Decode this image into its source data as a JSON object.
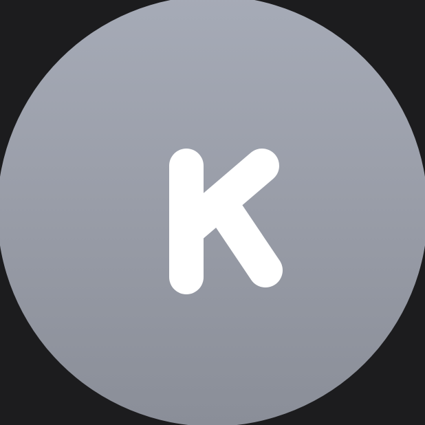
{
  "avatar": {
    "initial": "K",
    "background_top": "#a6abb7",
    "background_bottom": "#8a8e98",
    "letter_color": "#ffffff"
  },
  "page": {
    "background": "#1c1c1e"
  }
}
